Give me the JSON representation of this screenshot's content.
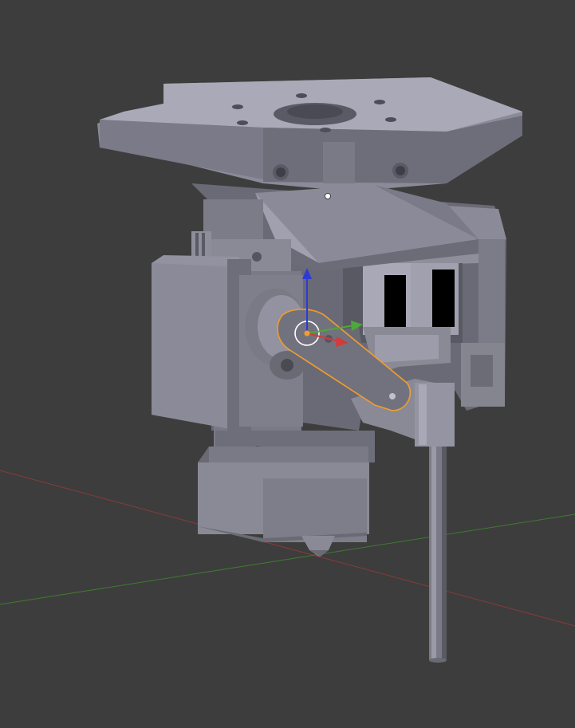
{
  "viewport": {
    "type": "3D viewport",
    "background": "#3d3d3d"
  },
  "colors": {
    "background": "#3d3d3d",
    "mesh_light": "#9a9aa8",
    "mesh_mid": "#7a7a88",
    "mesh_dark": "#55555e",
    "mesh_shadow": "#3e3e44",
    "selection_outline": "#f29d2b",
    "axis_x": "#d43a3a",
    "axis_y": "#4ea83a",
    "axis_z": "#2d3ad8",
    "grid_x_line": "#8a3a3a",
    "grid_y_line": "#3f7a32"
  },
  "scene": {
    "objects": [
      "mount-plate",
      "servo-body",
      "servo-arm",
      "probe-rod",
      "heater-block",
      "nozzle",
      "endstop-switches"
    ],
    "selected_object": "servo-arm",
    "gizmo": "translate"
  }
}
